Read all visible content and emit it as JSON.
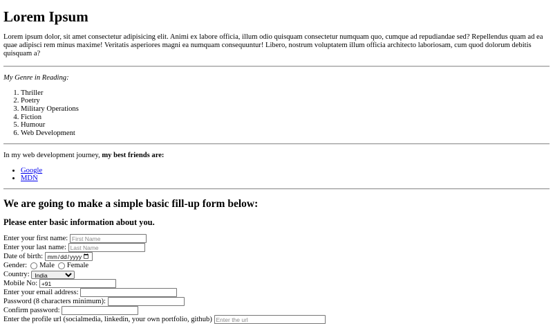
{
  "page": {
    "title": "Lorem Ipsum",
    "intro": "Lorem ipsum dolor, sit amet consectetur adipisicing elit. Animi ex labore officia, illum odio quisquam consectetur numquam quo, cumque ad repudiandae sed? Repellendus quam ad ea quae adipisci rem minus maxime! Veritatis asperiores magni ea numquam consequuntur! Libero, nostrum voluptatem illum officia architecto laboriosam, cum quod dolorum debitis quisquam a?"
  },
  "genres": {
    "heading": "My Genre in Reading:",
    "items": [
      "Thriller",
      "Poetry",
      "Military Operations",
      "Fiction",
      "Humour",
      "Web Development"
    ]
  },
  "friends": {
    "lead": "In my web development journey,",
    "bold": "my best friends are:",
    "links": [
      "Google",
      "MDN"
    ]
  },
  "form": {
    "heading": "We are going to make a simple basic fill-up form below:",
    "subheading": "Please enter basic information about you.",
    "first_name": {
      "label": "Enter your first name:",
      "placeholder": "First Name"
    },
    "last_name": {
      "label": "Enter your last name:",
      "placeholder": "Last Name"
    },
    "dob": {
      "label": "Date of birth:"
    },
    "gender": {
      "label": "Gender:",
      "male": "Male",
      "female": "Female"
    },
    "country": {
      "label": "Country:",
      "selected": "India"
    },
    "mobile": {
      "label": "Mobile No:",
      "value": "+91"
    },
    "email": {
      "label": "Enter your email address:"
    },
    "password": {
      "label": "Password (8 characters minimum):"
    },
    "confirm": {
      "label": "Confirm password:"
    },
    "profile": {
      "label": "Enter the profile url (socialmedia, linkedin, your own portfolio, github)",
      "placeholder": "Enter the url"
    }
  }
}
